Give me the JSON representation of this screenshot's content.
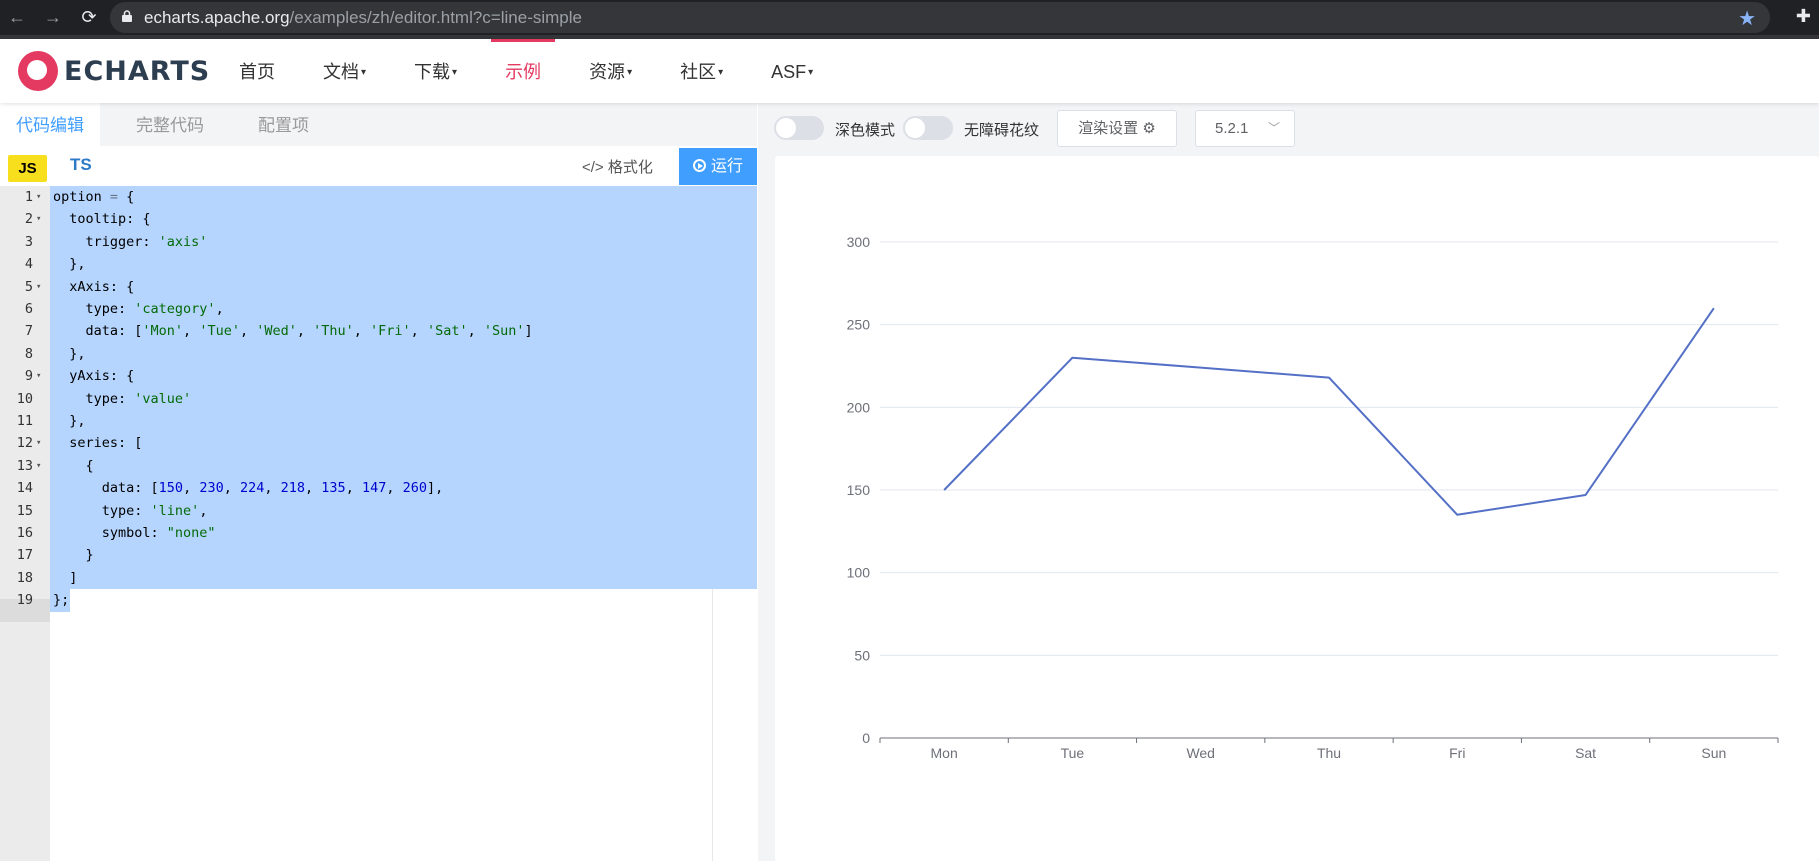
{
  "browser": {
    "url_host": "echarts.apache.org",
    "url_path": "/examples/zh/editor.html?c=line-simple",
    "back_icon": "arrow-left-icon",
    "forward_icon": "arrow-right-icon",
    "reload_icon": "reload-icon",
    "bookmark_icon": "star-icon",
    "extensions_icon": "puzzle-icon"
  },
  "header": {
    "logo_text": "ECHARTS",
    "nav": [
      {
        "label": "首页",
        "has_caret": false
      },
      {
        "label": "文档",
        "has_caret": true
      },
      {
        "label": "下载",
        "has_caret": true
      },
      {
        "label": "示例",
        "has_caret": false,
        "active": true
      },
      {
        "label": "资源",
        "has_caret": true
      },
      {
        "label": "社区",
        "has_caret": true
      },
      {
        "label": "ASF",
        "has_caret": true
      }
    ],
    "caret": "▾",
    "accent_color": "#e43961"
  },
  "editor": {
    "tabs": [
      "代码编辑",
      "完整代码",
      "配置项"
    ],
    "active_tab": "代码编辑",
    "lang_js": "JS",
    "lang_ts": "TS",
    "format_label": "格式化",
    "format_icon": "code-icon",
    "run_label": "运行",
    "run_icon": "play-circle-icon",
    "lines": [
      {
        "n": "1",
        "fold": true,
        "html": "option <span class=\"c-op\">=</span> {"
      },
      {
        "n": "2",
        "fold": true,
        "html": "  tooltip: {"
      },
      {
        "n": "3",
        "fold": false,
        "html": "    trigger: <span class=\"c-str\">'axis'</span>"
      },
      {
        "n": "4",
        "fold": false,
        "html": "  },"
      },
      {
        "n": "5",
        "fold": true,
        "html": "  xAxis: {"
      },
      {
        "n": "6",
        "fold": false,
        "html": "    type: <span class=\"c-str\">'category'</span>,"
      },
      {
        "n": "7",
        "fold": false,
        "html": "    data: [<span class=\"c-str\">'Mon'</span>, <span class=\"c-str\">'Tue'</span>, <span class=\"c-str\">'Wed'</span>, <span class=\"c-str\">'Thu'</span>, <span class=\"c-str\">'Fri'</span>, <span class=\"c-str\">'Sat'</span>, <span class=\"c-str\">'Sun'</span>]"
      },
      {
        "n": "8",
        "fold": false,
        "html": "  },"
      },
      {
        "n": "9",
        "fold": true,
        "html": "  yAxis: {"
      },
      {
        "n": "10",
        "fold": false,
        "html": "    type: <span class=\"c-str\">'value'</span>"
      },
      {
        "n": "11",
        "fold": false,
        "html": "  },"
      },
      {
        "n": "12",
        "fold": true,
        "html": "  series: ["
      },
      {
        "n": "13",
        "fold": true,
        "html": "    {"
      },
      {
        "n": "14",
        "fold": false,
        "html": "      data: [<span class=\"c-num\">150</span>, <span class=\"c-num\">230</span>, <span class=\"c-num\">224</span>, <span class=\"c-num\">218</span>, <span class=\"c-num\">135</span>, <span class=\"c-num\">147</span>, <span class=\"c-num\">260</span>],"
      },
      {
        "n": "15",
        "fold": false,
        "html": "      type: <span class=\"c-str\">'line'</span>,"
      },
      {
        "n": "16",
        "fold": false,
        "html": "      symbol: <span class=\"c-str\">\"none\"</span>"
      },
      {
        "n": "17",
        "fold": false,
        "html": "    }"
      },
      {
        "n": "18",
        "fold": false,
        "html": "  ]"
      },
      {
        "n": "19",
        "fold": false,
        "html": "};"
      }
    ],
    "fold_glyph": "▾"
  },
  "preview": {
    "dark_mode_label": "深色模式",
    "decal_label": "无障碍花纹",
    "render_settings_label": "渲染设置",
    "render_settings_icon": "gear-icon",
    "version": "5.2.1",
    "version_icon": "chevron-down-icon"
  },
  "chart_data": {
    "type": "line",
    "categories": [
      "Mon",
      "Tue",
      "Wed",
      "Thu",
      "Fri",
      "Sat",
      "Sun"
    ],
    "series": [
      {
        "values": [
          150,
          230,
          224,
          218,
          135,
          147,
          260
        ],
        "color": "#5470c6"
      }
    ],
    "ylim": [
      0,
      300
    ],
    "yticks": [
      0,
      50,
      100,
      150,
      200,
      250,
      300
    ],
    "grid": true
  }
}
